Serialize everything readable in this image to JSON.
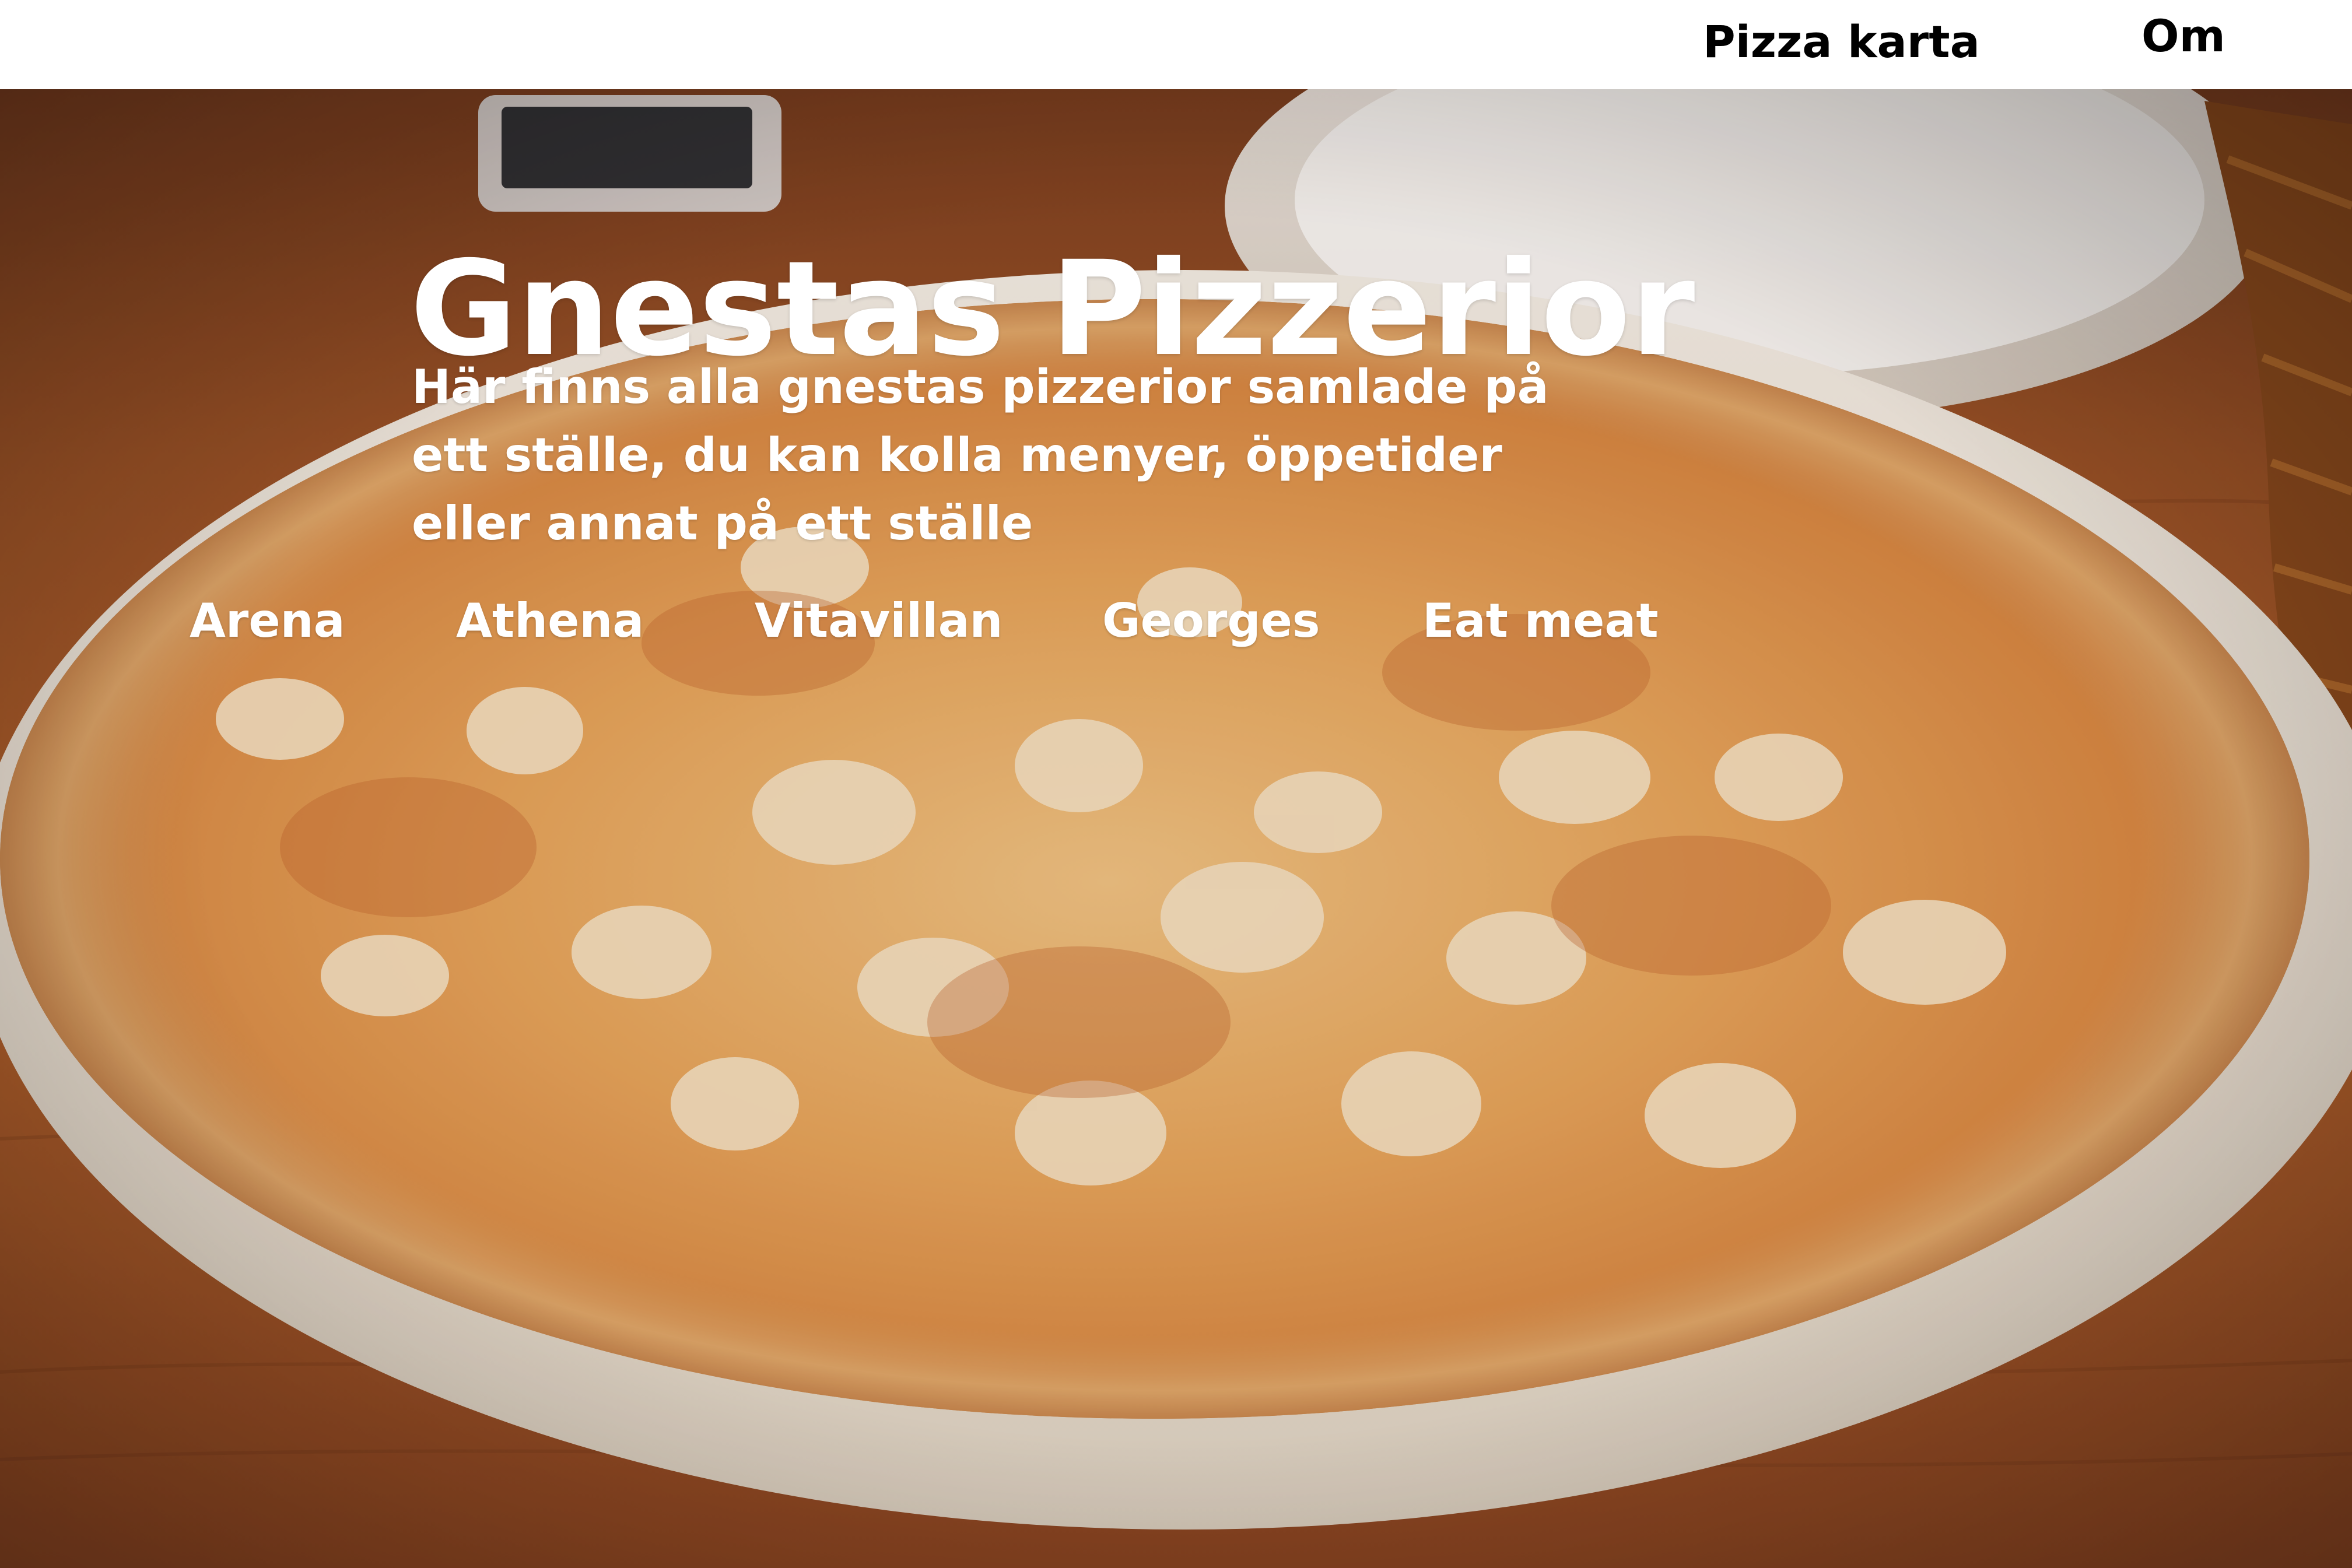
{
  "nav": {
    "pizza_map_label": "Pizza karta",
    "about_label": "Om"
  },
  "hero": {
    "title": "Gnestas Pizzerior",
    "description": "Här finns alla gnestas pizzerior samlade på ett ställe, du kan kolla menyer, öppetider eller annat på ett ställe"
  },
  "pizzerias": [
    {
      "name": "Arena"
    },
    {
      "name": "Athena"
    },
    {
      "name": "Vitavillan"
    },
    {
      "name": "Georges"
    },
    {
      "name": "Eat meat"
    }
  ],
  "colors": {
    "nav_text": "#000000",
    "hero_text": "#ffffff",
    "background": "#ffffff"
  }
}
